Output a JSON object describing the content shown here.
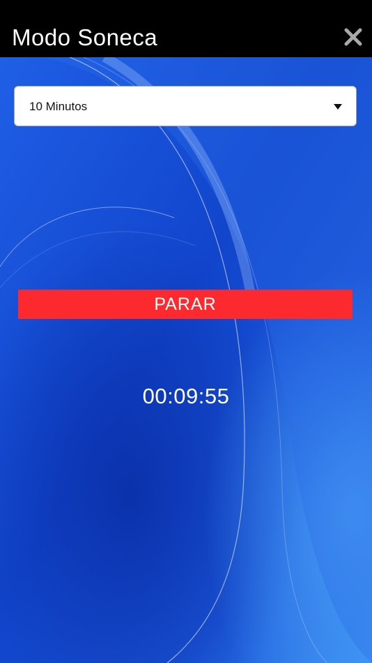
{
  "header": {
    "title": "Modo Soneca",
    "close_icon": "close-icon"
  },
  "timer_select": {
    "selected": "10 Minutos",
    "caret_icon": "caret-down-icon"
  },
  "stop_button": {
    "label": "PARAR"
  },
  "countdown": {
    "value": "00:09:55"
  },
  "colors": {
    "header_bg": "#000000",
    "background": "#1553d6",
    "stop_button": "#fc2a2e"
  }
}
